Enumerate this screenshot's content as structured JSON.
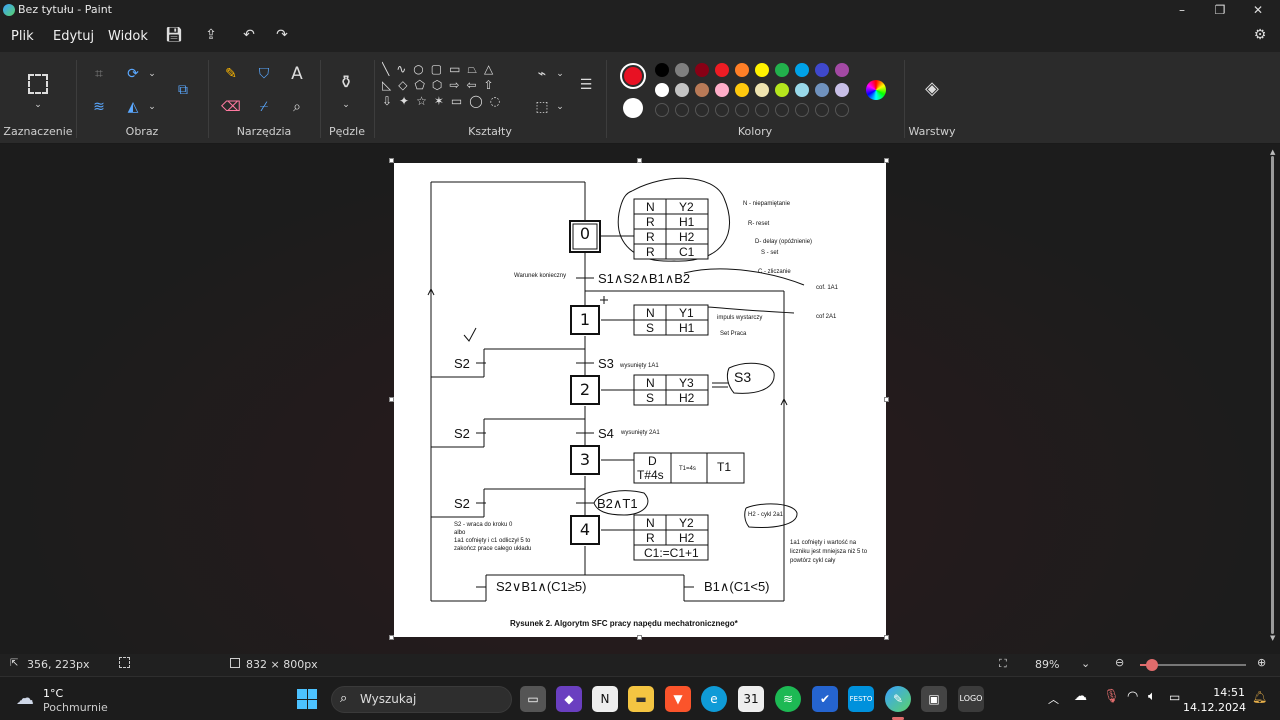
{
  "window": {
    "title": "Bez tytułu - Paint",
    "min": "–",
    "max": "❐",
    "close": "✕"
  },
  "menu": {
    "file": "Plik",
    "edit": "Edytuj",
    "view": "Widok"
  },
  "ribbon": {
    "groups": {
      "selection": "Zaznaczenie",
      "image": "Obraz",
      "tools": "Narzędzia",
      "brushes": "Pędzle",
      "shapes": "Kształty",
      "colors": "Kolory",
      "layers": "Warstwy"
    },
    "primary_color": "#e81123",
    "secondary_color": "#ffffff",
    "palette_row1": [
      "#000000",
      "#7f7f7f",
      "#880015",
      "#ed1c24",
      "#ff7f27",
      "#fff200",
      "#22b14c",
      "#00a2e8",
      "#3f48cc",
      "#a349a4"
    ],
    "palette_row2": [
      "#ffffff",
      "#c3c3c3",
      "#b97a57",
      "#ffaec9",
      "#ffc90e",
      "#efe4b0",
      "#b5e61d",
      "#99d9ea",
      "#7092be",
      "#c8bfe7"
    ]
  },
  "diagram": {
    "steps": [
      "0",
      "1",
      "2",
      "3",
      "4"
    ],
    "step0_actions": [
      [
        "N",
        "Y2"
      ],
      [
        "R",
        "H1"
      ],
      [
        "R",
        "H2"
      ],
      [
        "R",
        "C1"
      ]
    ],
    "step1_actions": [
      [
        "N",
        "Y1"
      ],
      [
        "S",
        "H1"
      ]
    ],
    "step2_actions": [
      [
        "N",
        "Y3"
      ],
      [
        "S",
        "H2"
      ]
    ],
    "step3_actions": {
      "a": "D",
      "b": "T#4s",
      "mid": "T1=4s",
      "c": "T1"
    },
    "step4_actions": [
      [
        "N",
        "Y2"
      ],
      [
        "R",
        "H2"
      ]
    ],
    "step4_extra": "C1:=C1+1",
    "t0": "S1∧S2∧B1∧B2",
    "t0_label": "Warunek konieczny",
    "t1": "S3",
    "t1_note": "wysunięty 1A1",
    "t2": "S4",
    "t2_note": "wysunięty 2A1",
    "t3": "B2∧T1",
    "s2_label": "S2",
    "t_left": "S2∨B1∧(C1≥5)",
    "t_right": "B1∧(C1<5)",
    "legend": [
      "N - niepamiętanie",
      "R- reset",
      "D- delay (opóźnienie)",
      "S - set",
      "C - zliczanie"
    ],
    "cof1": "cof. 1A1",
    "cof2": "cof 2A1",
    "impuls": "impuls wystarczy",
    "set_praca": "Set Praca",
    "h2_note": "H2 - cykl 2a1",
    "note_left": [
      "S2 - wraca do kroku 0",
      "albo",
      "1a1 cofnięty i c1 odliczył 5 to",
      "zakończ prace całego układu"
    ],
    "note_right": [
      "1a1 cofnięty i wartość na",
      "liczniku jest mniejsza niż 5 to",
      "powtórz cykl cały"
    ],
    "scribble": "S3",
    "caption": "Rysunek 2. Algorytm SFC pracy napędu mechatronicznego*"
  },
  "status": {
    "cursor": "356, 223px",
    "size": "832 × 800px",
    "zoom": "89%"
  },
  "taskbar": {
    "temp": "1°C",
    "weather": "Pochmurnie",
    "search": "Wyszukaj",
    "time": "14:51",
    "date": "14.12.2024"
  }
}
